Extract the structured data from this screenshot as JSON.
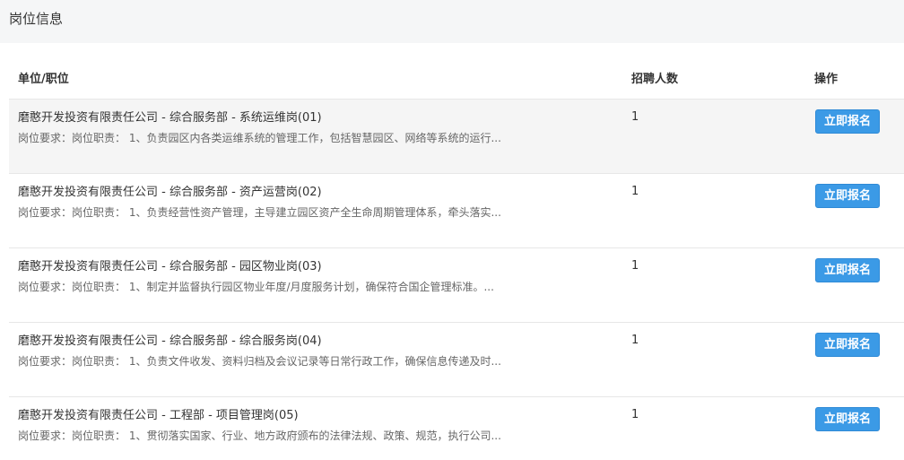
{
  "section": {
    "title": "岗位信息"
  },
  "table": {
    "headers": {
      "unit": "单位/职位",
      "count": "招聘人数",
      "action": "操作"
    },
    "rows": [
      {
        "title": "磨憨开发投资有限责任公司 - 综合服务部 - 系统运维岗(01)",
        "requirement": "岗位要求：岗位职责： 1、负责园区内各类运维系统的管理工作，包括智慧园区、网络等系统的运行...",
        "count": "1",
        "button": "立即报名"
      },
      {
        "title": "磨憨开发投资有限责任公司 - 综合服务部 - 资产运营岗(02)",
        "requirement": "岗位要求：岗位职责： 1、负责经营性资产管理，主导建立园区资产全生命周期管理体系，牵头落实...",
        "count": "1",
        "button": "立即报名"
      },
      {
        "title": "磨憨开发投资有限责任公司 - 综合服务部 - 园区物业岗(03)",
        "requirement": "岗位要求：岗位职责： 1、制定并监督执行园区物业年度/月度服务计划，确保符合国企管理标准。...",
        "count": "1",
        "button": "立即报名"
      },
      {
        "title": "磨憨开发投资有限责任公司 - 综合服务部 - 综合服务岗(04)",
        "requirement": "岗位要求：岗位职责： 1、负责文件收发、资料归档及会议记录等日常行政工作，确保信息传递及时...",
        "count": "1",
        "button": "立即报名"
      },
      {
        "title": "磨憨开发投资有限责任公司 - 工程部 - 项目管理岗(05)",
        "requirement": "岗位要求：岗位职责： 1、贯彻落实国家、行业、地方政府颁布的法律法规、政策、规范，执行公司...",
        "count": "1",
        "button": "立即报名"
      }
    ]
  }
}
